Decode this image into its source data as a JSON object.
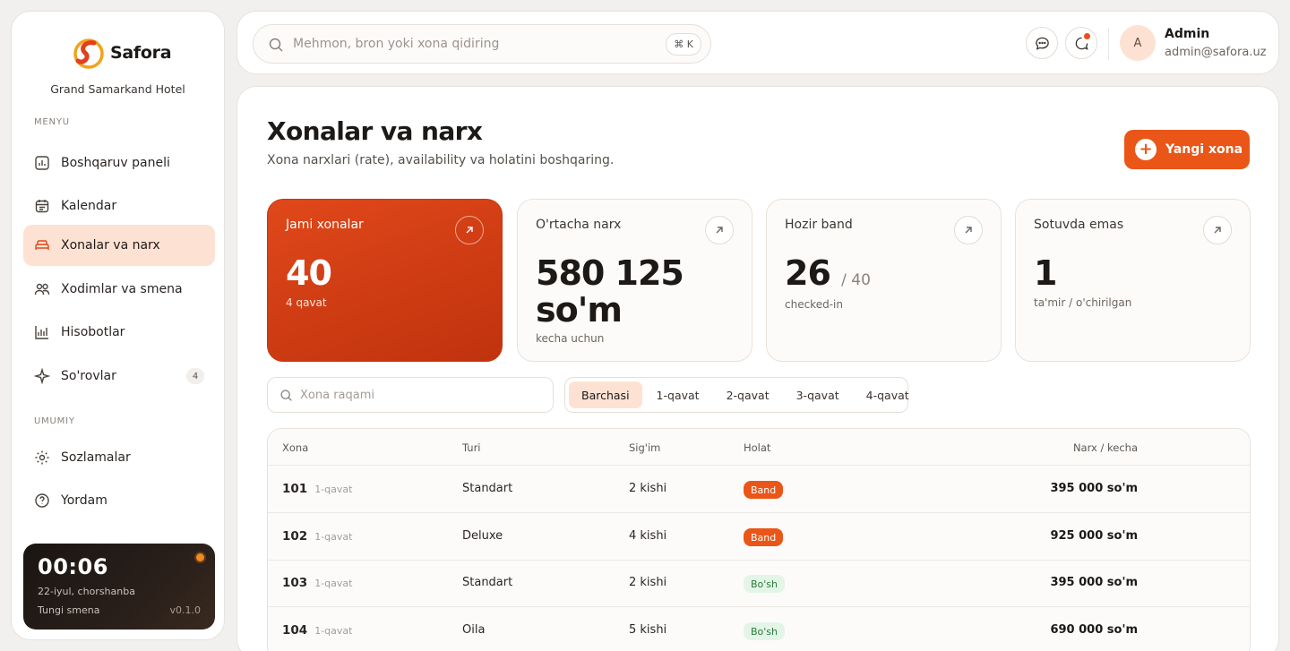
{
  "brand": {
    "name": "Safora",
    "hotel": "Grand Samarkand Hotel"
  },
  "sidebar": {
    "menu_label": "MENYU",
    "items": [
      {
        "label": "Boshqaruv paneli"
      },
      {
        "label": "Kalendar"
      },
      {
        "label": "Xonalar va narx"
      },
      {
        "label": "Xodimlar va smena"
      },
      {
        "label": "Hisobotlar"
      },
      {
        "label": "So'rovlar",
        "badge": "4"
      }
    ],
    "general_label": "UMUMIY",
    "general_items": [
      {
        "label": "Sozlamalar"
      },
      {
        "label": "Yordam"
      }
    ],
    "clock": {
      "time": "00:06",
      "date": "22-iyul, chorshanba",
      "shift": "Tungi smena",
      "version": "v0.1.0"
    }
  },
  "topbar": {
    "search_placeholder": "Mehmon, bron yoki xona qidiring",
    "shortcut": "⌘ K",
    "user": {
      "initial": "A",
      "name": "Admin",
      "email": "admin@safora.uz"
    }
  },
  "page": {
    "title": "Xonalar va narx",
    "subtitle": "Xona narxlari (rate), availability va holatini boshqaring.",
    "new_button": "Yangi xona"
  },
  "stats": [
    {
      "label": "Jami xonalar",
      "value": "40",
      "note": "4 qavat"
    },
    {
      "label": "O'rtacha narx",
      "value": "580 125 so'm",
      "note": "kecha uchun"
    },
    {
      "label": "Hozir band",
      "value": "26",
      "suffix": "/ 40",
      "note": "checked-in"
    },
    {
      "label": "Sotuvda emas",
      "value": "1",
      "note": "ta'mir / o'chirilgan"
    }
  ],
  "filters": {
    "room_search_placeholder": "Xona raqami",
    "floors": [
      "Barchasi",
      "1-qavat",
      "2-qavat",
      "3-qavat",
      "4-qavat"
    ],
    "active_floor": "Barchasi"
  },
  "table": {
    "columns": [
      "Xona",
      "Turi",
      "Sig'im",
      "Holat",
      "Narx / kecha"
    ],
    "rows": [
      {
        "room": "101",
        "floor": "1-qavat",
        "type": "Standart",
        "capacity": "2 kishi",
        "status": "Band",
        "price": "395 000 so'm"
      },
      {
        "room": "102",
        "floor": "1-qavat",
        "type": "Deluxe",
        "capacity": "4 kishi",
        "status": "Band",
        "price": "925 000 so'm"
      },
      {
        "room": "103",
        "floor": "1-qavat",
        "type": "Standart",
        "capacity": "2 kishi",
        "status": "Bo'sh",
        "price": "395 000 so'm"
      },
      {
        "room": "104",
        "floor": "1-qavat",
        "type": "Oila",
        "capacity": "5 kishi",
        "status": "Bo'sh",
        "price": "690 000 so'm"
      }
    ]
  },
  "colors": {
    "accent": "#ea5618",
    "accent_soft": "#fde2d3",
    "free_bg": "#e3f5e7",
    "free_text": "#2a7a3e"
  }
}
